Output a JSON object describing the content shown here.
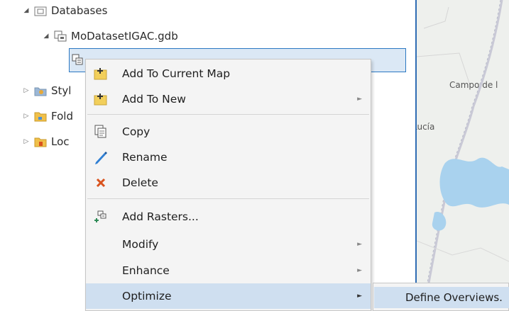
{
  "catalog": {
    "databases_label": "Databases",
    "gdb_label": "MoDatasetIGAC.gdb",
    "items": [
      {
        "label": "Styl",
        "icon": "styles-icon"
      },
      {
        "label": "Fold",
        "icon": "folders-icon"
      },
      {
        "label": "Loc",
        "icon": "locators-icon"
      }
    ]
  },
  "map": {
    "labels": [
      "Campo de l",
      "Lucía"
    ]
  },
  "context_menu": {
    "items": [
      {
        "label": "Add To Current Map",
        "icon": "add-to-map-icon"
      },
      {
        "label": "Add To New",
        "icon": "add-to-new-icon",
        "submenu": true
      },
      {
        "label": "Copy",
        "icon": "copy-icon"
      },
      {
        "label": "Rename",
        "icon": "rename-icon"
      },
      {
        "label": "Delete",
        "icon": "delete-icon"
      },
      {
        "label": "Add Rasters...",
        "icon": "add-rasters-icon"
      },
      {
        "label": "Modify",
        "submenu": true
      },
      {
        "label": "Enhance",
        "submenu": true
      },
      {
        "label": "Optimize",
        "submenu": true,
        "highlighted": true
      }
    ]
  },
  "submenu": {
    "items": [
      {
        "label": "Define Overviews."
      }
    ]
  },
  "colors": {
    "selection": "#dbe8f5",
    "selection_border": "#2b78c2",
    "hover": "#cfdff0",
    "map_border": "#2f6db4",
    "delete_icon": "#d9531e"
  }
}
